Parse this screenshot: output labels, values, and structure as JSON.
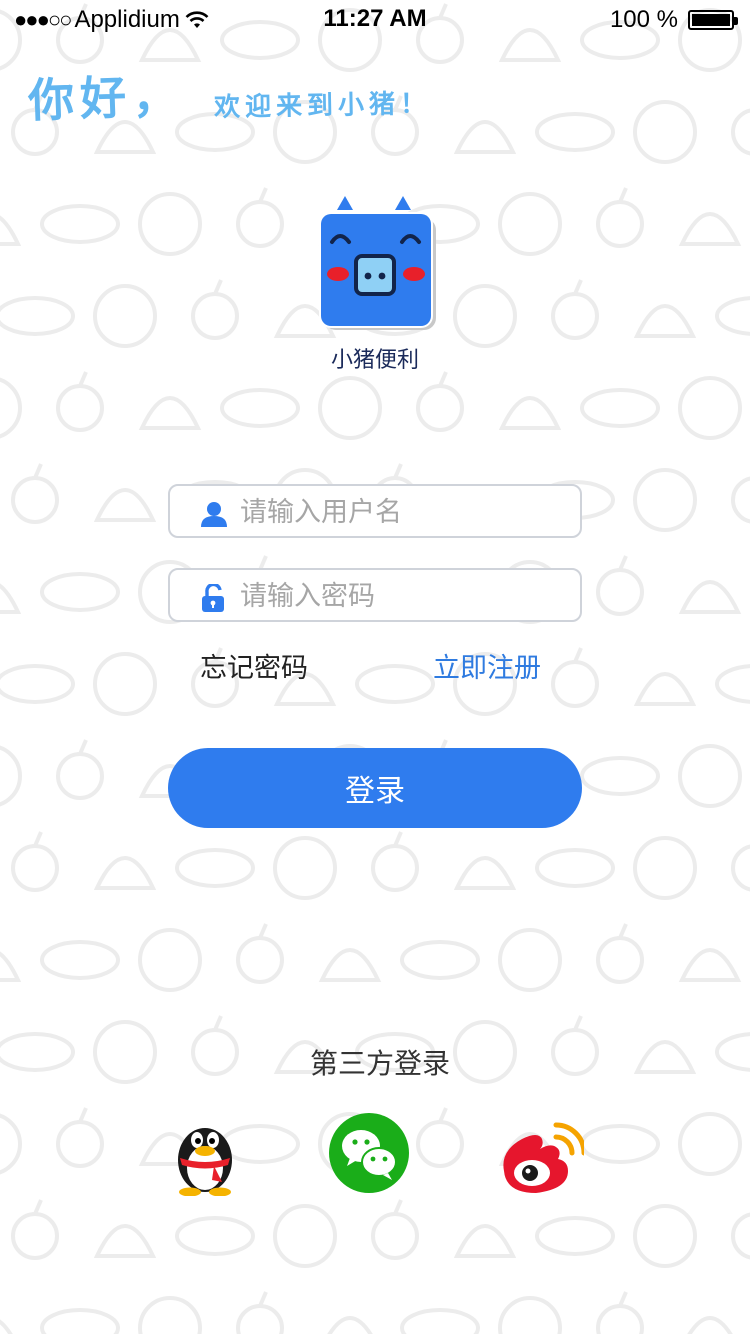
{
  "status_bar": {
    "carrier": "Applidium",
    "time": "11:27 AM",
    "battery": "100 %"
  },
  "greeting": {
    "hello": "你好，",
    "welcome": "欢迎来到小猪！"
  },
  "app": {
    "name": "小猪便利",
    "brand_color": "#2f7cee"
  },
  "form": {
    "username_placeholder": "请输入用户名",
    "password_placeholder": "请输入密码",
    "forgot_label": "忘记密码",
    "register_label": "立即注册",
    "login_label": "登录"
  },
  "third_party": {
    "title": "第三方登录",
    "providers": [
      {
        "icon": "qq-penguin-icon"
      },
      {
        "icon": "wechat-icon"
      },
      {
        "icon": "weibo-icon"
      }
    ]
  },
  "colors": {
    "accent": "#2f7cee",
    "link": "#2f7be0",
    "greeting": "#62b6f0",
    "wechat": "#1aad19",
    "weibo": "#e6162d"
  }
}
